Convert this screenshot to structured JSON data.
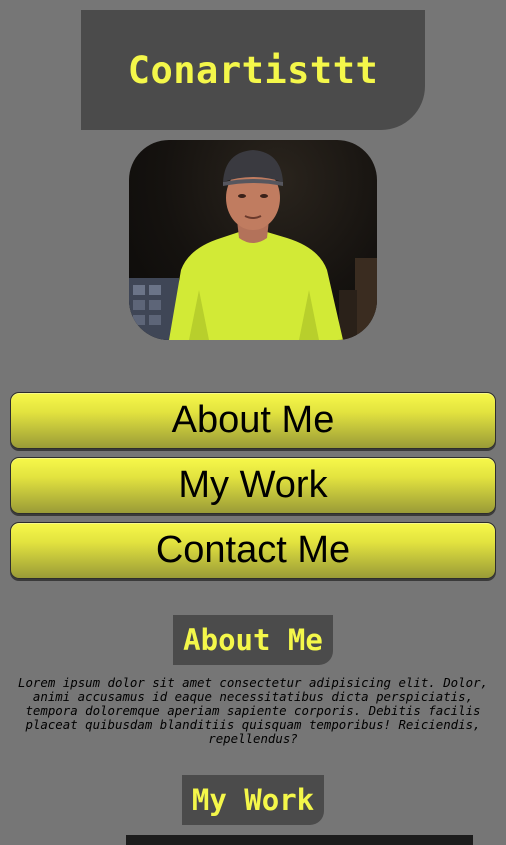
{
  "header": {
    "title": "Conartisttt"
  },
  "avatar": {
    "icon": "profile-photo",
    "colors": {
      "shirt": "#d9ef3a",
      "background": "#14110e"
    }
  },
  "nav": {
    "items": [
      {
        "label": "About Me"
      },
      {
        "label": "My Work"
      },
      {
        "label": "Contact Me"
      }
    ]
  },
  "about": {
    "title": "About Me",
    "text": "Lorem ipsum dolor sit amet consectetur adipisicing elit. Dolor, animi accusamus id eaque necessitatibus dicta perspiciatis, tempora doloremque aperiam sapiente corporis. Debitis facilis placeat quibusdam blanditiis quisquam temporibus! Reiciendis, repellendus?"
  },
  "work": {
    "title": "My Work"
  },
  "colors": {
    "background": "#767676",
    "panel": "#4b4b4b",
    "accent": "#f4f74a"
  }
}
